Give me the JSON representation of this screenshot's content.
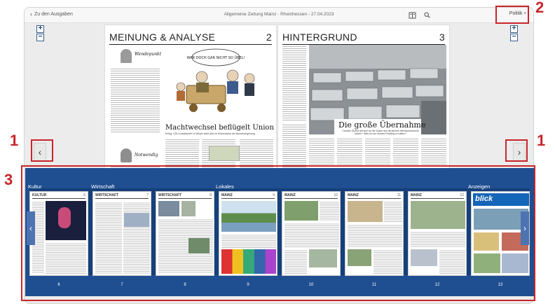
{
  "topbar": {
    "back_label": "Zu den Ausgaben",
    "title": "Allgemeine Zeitung Mainz - Rheinhessen - 27.04.2023",
    "section_label": "Politik",
    "icons": [
      "chevron-left-icon",
      "pages-icon",
      "search-icon",
      "chevron-down-icon"
    ]
  },
  "zoom": {
    "in": "+",
    "out": "−"
  },
  "spread": {
    "left": {
      "section": "MEINUNG & ANALYSE",
      "number": "2",
      "kommentar": "Wendepunkt",
      "cartoon_speech": "WAR DOCH GAR NICHT SO ÜBEL!",
      "headline": "Machtwechsel beflügelt Union",
      "subline": "Erfolg: CDU-Landeschef Le Weyer sieht sich im Rückenwind der Bundesregierung",
      "kommentar2": "Notwendig"
    },
    "right": {
      "section": "HINTERGRUND",
      "number": "3",
      "headline": "Die große Übernahme",
      "subline": "Carsten Globut will sich an die Spitze des deutschen Weinkonsortiums setzen / Was ist von seinem Einstieg zu halten?"
    }
  },
  "nav": {
    "prev": "‹",
    "next": "›"
  },
  "annotations": {
    "nav": "1",
    "section_dropdown": "2",
    "strip": "3"
  },
  "strip": {
    "groups": [
      "Kultur",
      "Wirtschaft",
      "Lokales",
      "Anzeigen"
    ],
    "thumbs": [
      {
        "name": "KULTUR",
        "page": "6"
      },
      {
        "name": "WIRTSCHAFT",
        "page": "7"
      },
      {
        "name": "WIRTSCHAFT",
        "page": "8"
      },
      {
        "name": "MAINZ",
        "page": "9"
      },
      {
        "name": "MAINZ",
        "page": "10"
      },
      {
        "name": "MAINZ",
        "page": "11"
      },
      {
        "name": "MAINZ",
        "page": "12"
      },
      {
        "name": "blick",
        "page": "13"
      }
    ]
  },
  "colors": {
    "strip": "#1f4e91",
    "annotation": "#c8252a"
  }
}
